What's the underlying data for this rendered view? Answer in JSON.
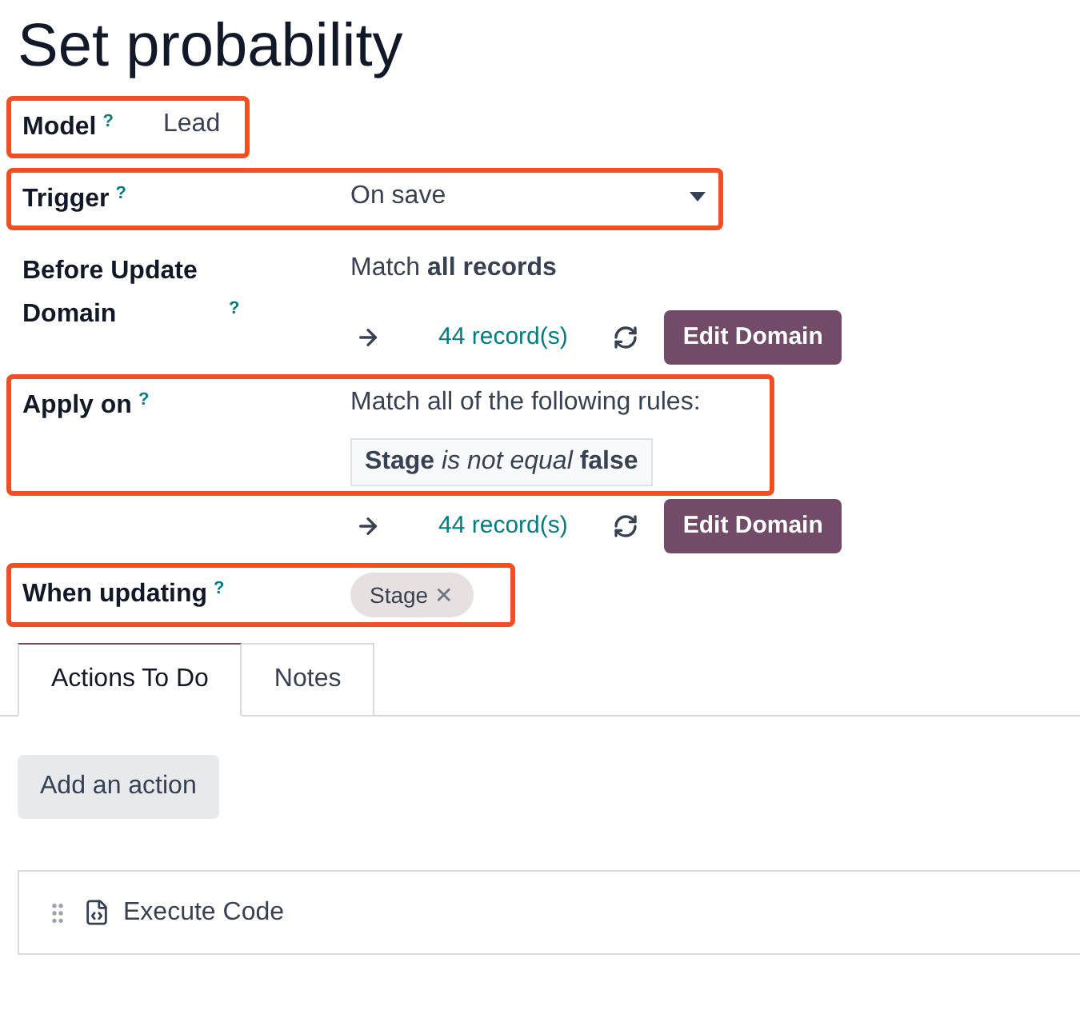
{
  "title": "Set probability",
  "fields": [
    {
      "kind": "text",
      "label": "Model",
      "help": "?",
      "highlighted": true,
      "value": "Lead"
    },
    {
      "kind": "select",
      "label": "Trigger",
      "help": "?",
      "highlighted": true,
      "value": "On save"
    },
    {
      "kind": "domain",
      "label": "Before Update Domain",
      "help": "?",
      "highlighted": false,
      "summary": "Match **all records**",
      "count": "44 record(s)",
      "button": "Edit Domain"
    },
    {
      "kind": "domain",
      "label": "Apply on",
      "help": "?",
      "highlighted": true,
      "summary": "Match all of the following rules:",
      "rule": "**Stage** *is not equal* **false**",
      "count": "44 record(s)",
      "button": "Edit Domain"
    },
    {
      "kind": "tags",
      "label": "When updating",
      "help": "?",
      "highlighted": true,
      "tags": [
        "Stage"
      ],
      "remove": "✕"
    }
  ],
  "tabs": [
    {
      "label": "Actions To Do",
      "selected": true
    },
    {
      "label": "Notes",
      "selected": false
    }
  ],
  "add_button": "Add an action",
  "actions": [
    {
      "label": "Execute Code"
    }
  ]
}
